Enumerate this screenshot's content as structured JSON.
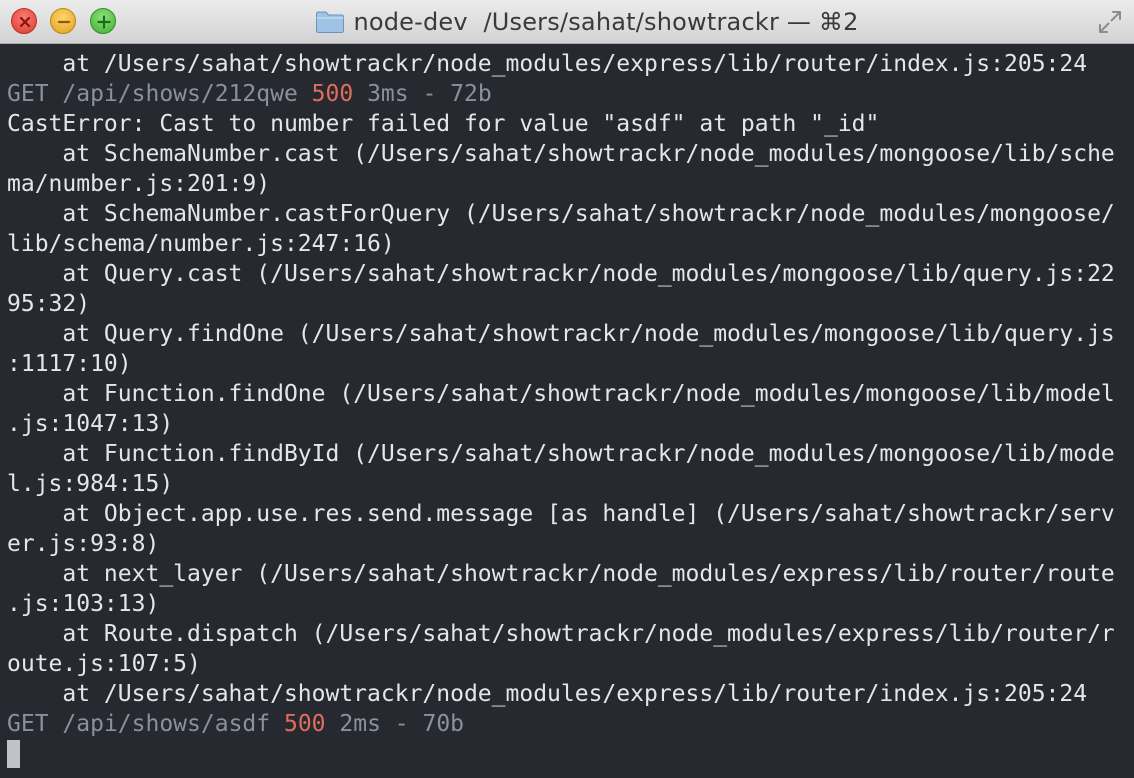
{
  "window": {
    "title": "node-dev  /Users/sahat/showtrackr — ⌘2",
    "icons": {
      "close": "close-button-icon",
      "minimize": "minimize-button-icon",
      "zoom": "zoom-button-icon",
      "folder": "folder-icon",
      "fullscreen": "fullscreen-arrows-icon"
    }
  },
  "colors": {
    "background": "#262a30",
    "text": "#e4e6e8",
    "dim": "#8a9199",
    "status_error": "#e06c5e"
  },
  "terminal": {
    "line1": "    at /Users/sahat/showtrackr/node_modules/express/lib/router/index.js:205:24",
    "log1": {
      "method": "GET",
      "path": "/api/shows/212qwe",
      "status": "500",
      "meta": "3ms - 72b"
    },
    "error": "CastError: Cast to number failed for value \"asdf\" at path \"_id\"",
    "stack": [
      "    at SchemaNumber.cast (/Users/sahat/showtrackr/node_modules/mongoose/lib/sche",
      "ma/number.js:201:9)",
      "    at SchemaNumber.castForQuery (/Users/sahat/showtrackr/node_modules/mongoose/",
      "lib/schema/number.js:247:16)",
      "    at Query.cast (/Users/sahat/showtrackr/node_modules/mongoose/lib/query.js:22",
      "95:32)",
      "    at Query.findOne (/Users/sahat/showtrackr/node_modules/mongoose/lib/query.js",
      ":1117:10)",
      "    at Function.findOne (/Users/sahat/showtrackr/node_modules/mongoose/lib/model",
      ".js:1047:13)",
      "    at Function.findById (/Users/sahat/showtrackr/node_modules/mongoose/lib/mode",
      "l.js:984:15)",
      "    at Object.app.use.res.send.message [as handle] (/Users/sahat/showtrackr/serv",
      "er.js:93:8)",
      "    at next_layer (/Users/sahat/showtrackr/node_modules/express/lib/router/route",
      ".js:103:13)",
      "    at Route.dispatch (/Users/sahat/showtrackr/node_modules/express/lib/router/r",
      "oute.js:107:5)",
      "    at /Users/sahat/showtrackr/node_modules/express/lib/router/index.js:205:24"
    ],
    "log2": {
      "method": "GET",
      "path": "/api/shows/asdf",
      "status": "500",
      "meta": "2ms - 70b"
    }
  }
}
